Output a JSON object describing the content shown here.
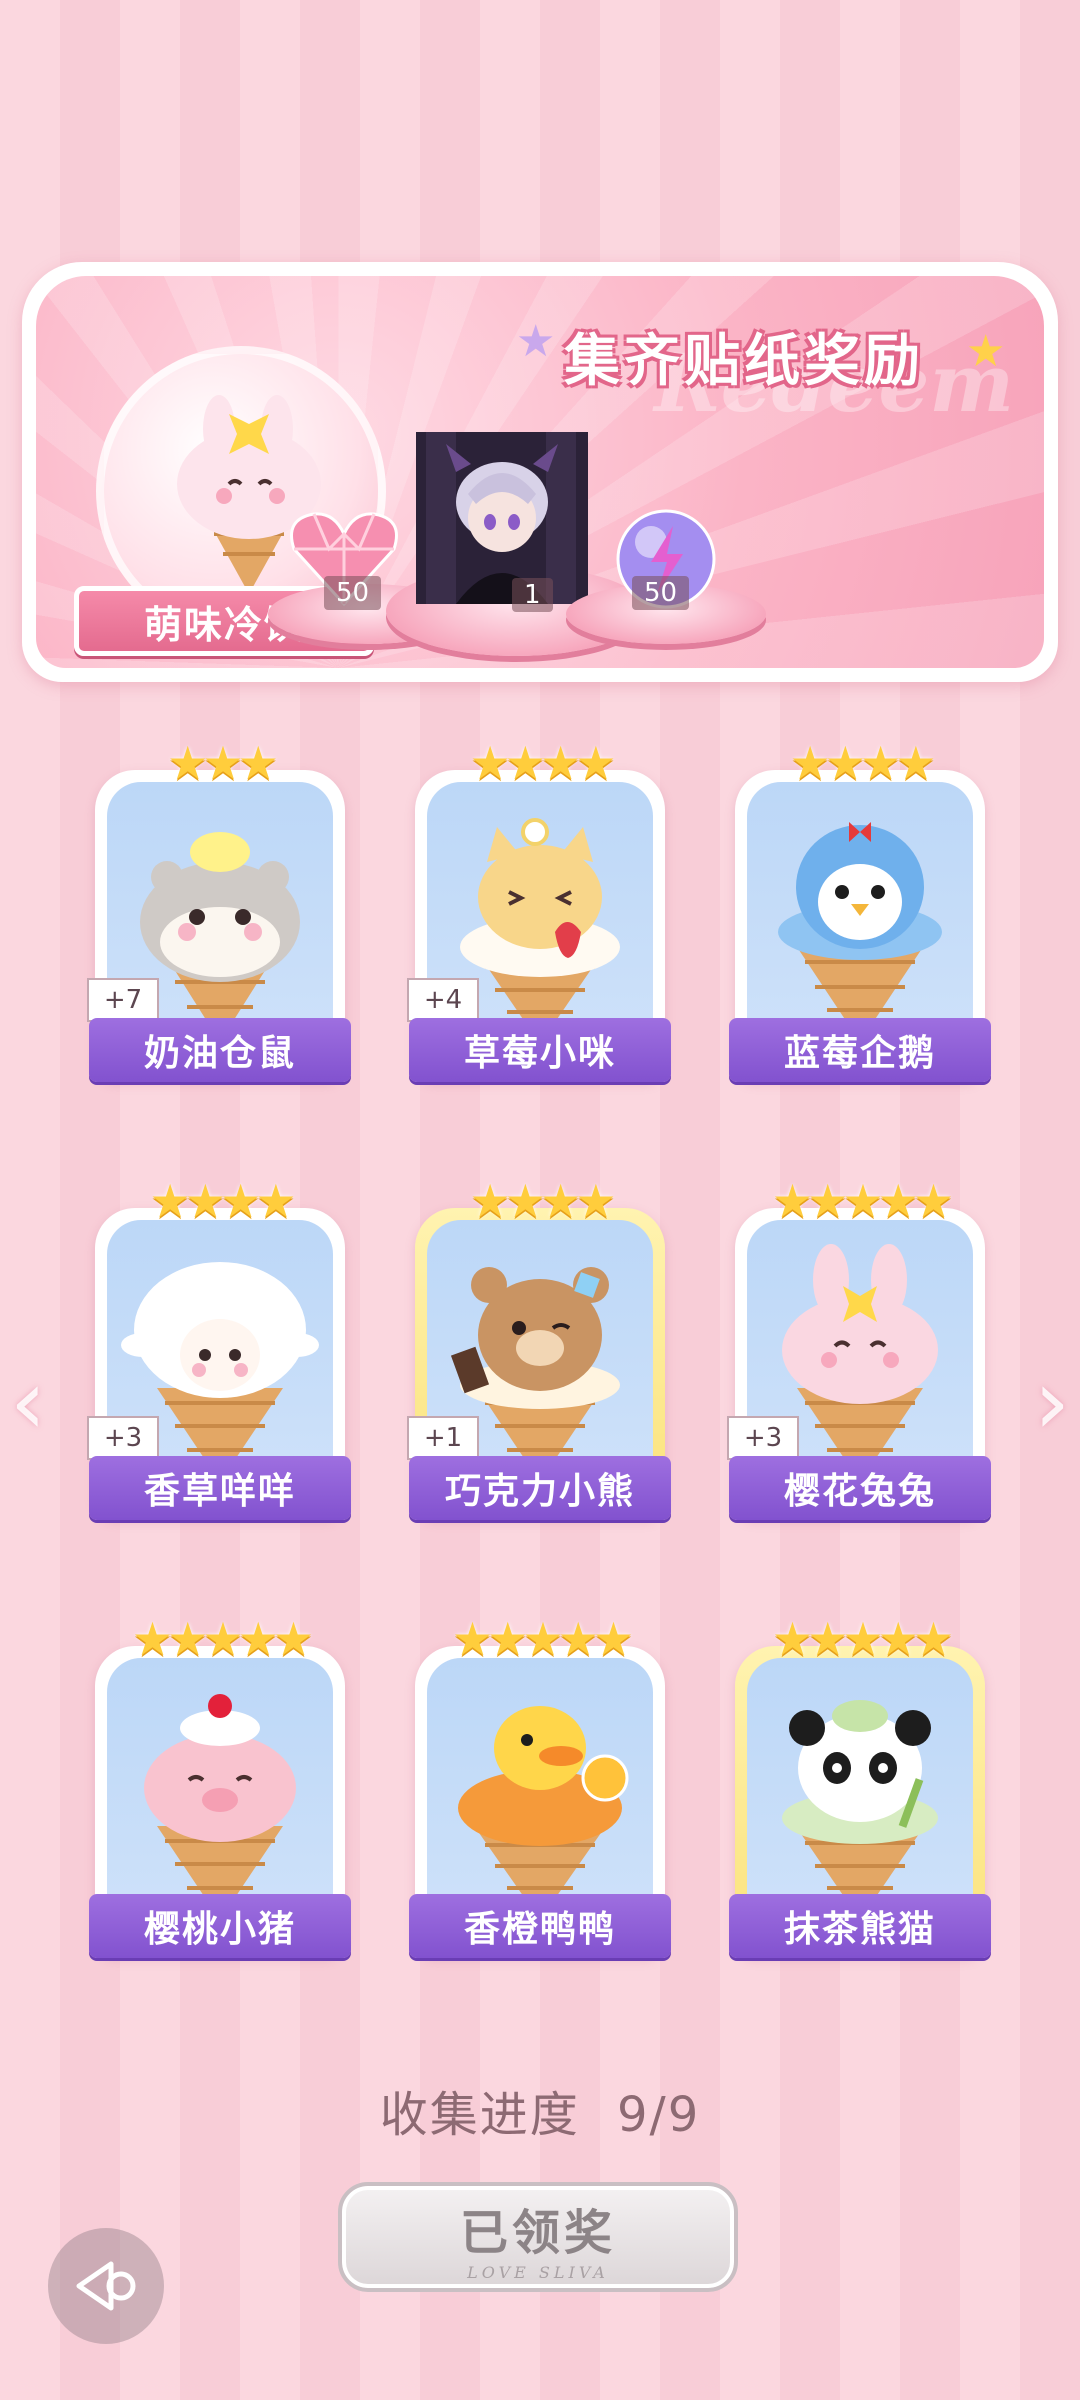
{
  "reward_panel": {
    "title": "集齐贴纸奖励",
    "watermark": "Redeem",
    "category": "萌味冷饮",
    "rewards": [
      {
        "icon": "pink-heart-gem-icon",
        "count": "50"
      },
      {
        "icon": "character-portrait",
        "count": "1"
      },
      {
        "icon": "purple-energy-orb-icon",
        "count": "50"
      }
    ]
  },
  "cards": [
    {
      "name": "奶油仓鼠",
      "stars": "★★★",
      "badge": "+7",
      "animal": "hamster"
    },
    {
      "name": "草莓小咪",
      "stars": "★★★★",
      "badge": "+4",
      "animal": "cat"
    },
    {
      "name": "蓝莓企鹅",
      "stars": "★★★★",
      "badge": "",
      "animal": "penguin"
    },
    {
      "name": "香草咩咩",
      "stars": "★★★★",
      "badge": "+3",
      "animal": "sheep"
    },
    {
      "name": "巧克力小熊",
      "stars": "★★★★",
      "badge": "+1",
      "animal": "bear"
    },
    {
      "name": "樱花兔兔",
      "stars": "★★★★★",
      "badge": "+3",
      "animal": "bunny"
    },
    {
      "name": "樱桃小猪",
      "stars": "★★★★★",
      "badge": "",
      "animal": "pig"
    },
    {
      "name": "香橙鸭鸭",
      "stars": "★★★★★",
      "badge": "",
      "animal": "duck"
    },
    {
      "name": "抹茶熊猫",
      "stars": "★★★★★",
      "badge": "",
      "animal": "panda"
    }
  ],
  "progress": {
    "label": "收集进度",
    "value": "9/9"
  },
  "claim_button": {
    "label": "已领奖",
    "sub": "LOVE SLIVA"
  },
  "colors": {
    "accent_pink": "#e46b8f",
    "plate_purple": "#8252cf",
    "star_gold": "#ffcd3c"
  }
}
